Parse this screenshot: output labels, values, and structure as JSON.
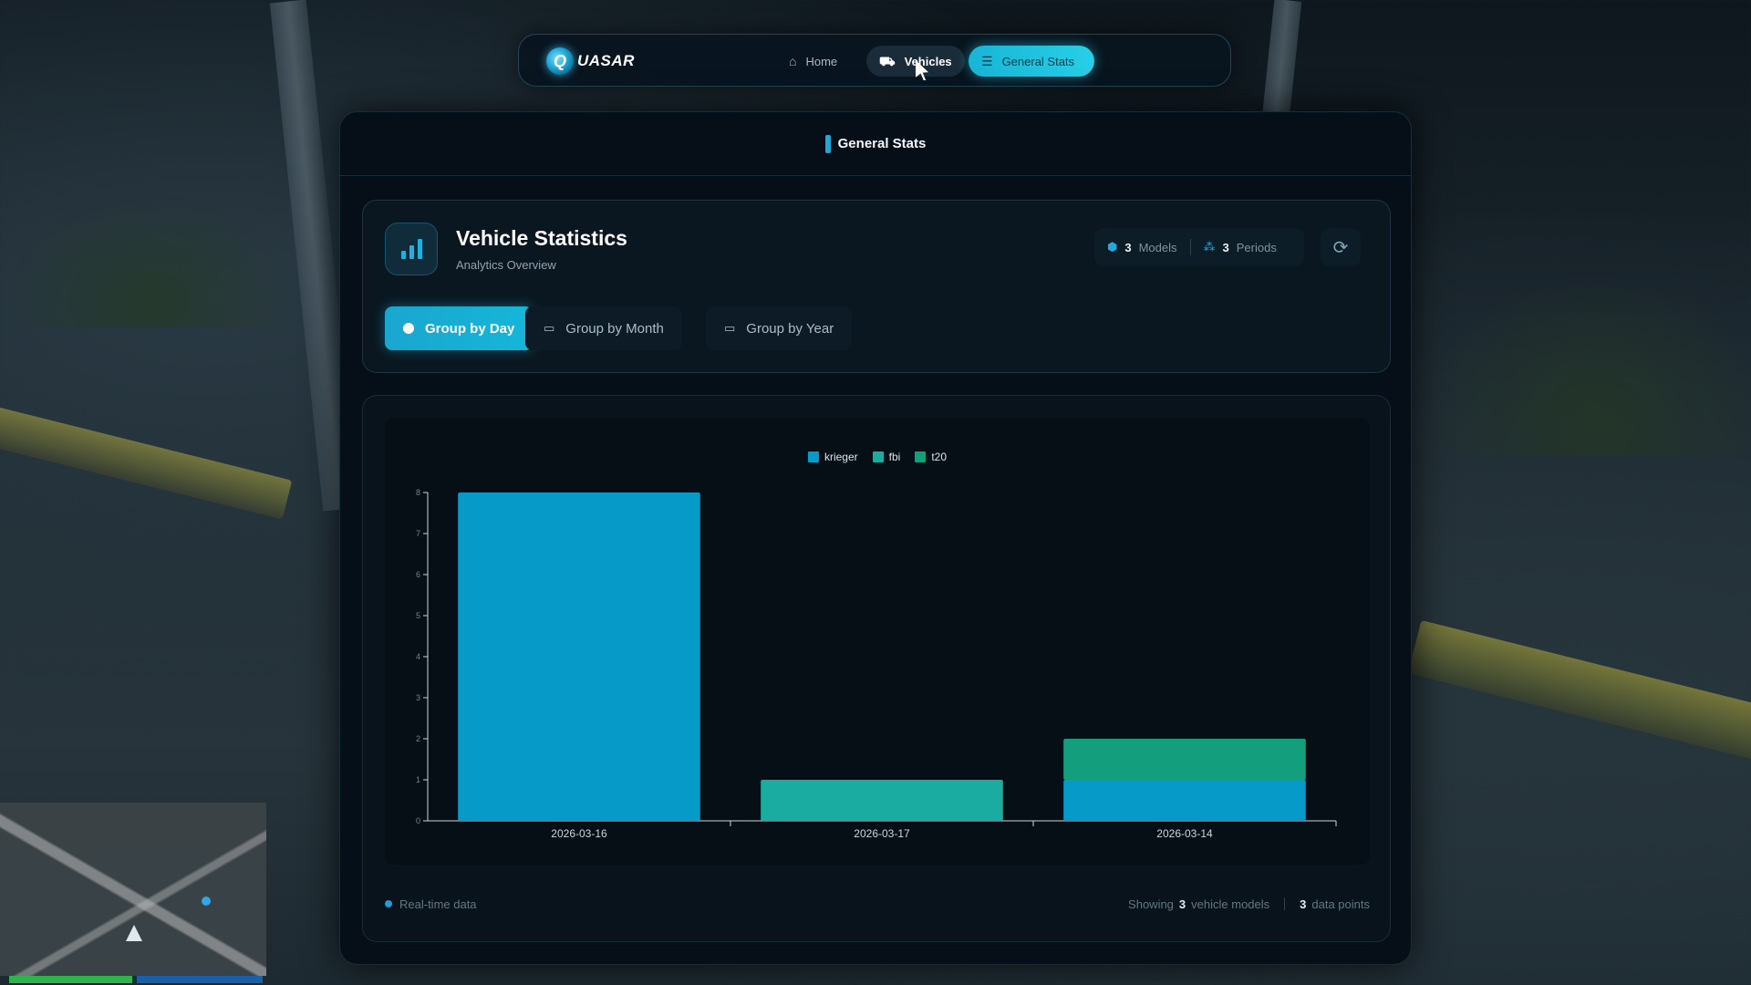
{
  "nav": {
    "logo_mark": "Q",
    "logo_text": "UASAR",
    "home_label": "Home",
    "vehicles_label": "Vehicles",
    "general_stats_label": "General Stats"
  },
  "panel": {
    "title": "General Stats"
  },
  "header": {
    "title": "Vehicle Statistics",
    "subtitle": "Analytics Overview",
    "models_count": "3",
    "models_label": "Models",
    "periods_count": "3",
    "periods_label": "Periods"
  },
  "group_by": {
    "day_label": "Group by Day",
    "month_label": "Group by Month",
    "year_label": "Group by Year",
    "selected": "day"
  },
  "colors": {
    "krieger": "#069ac8",
    "fbi": "#1aaca0",
    "t20": "#139e7d",
    "accent": "#16b6d9"
  },
  "chart_data": {
    "type": "bar",
    "stacked": true,
    "categories": [
      "2026-03-16",
      "2026-03-17",
      "2026-03-14"
    ],
    "series": [
      {
        "name": "krieger",
        "values": [
          8,
          0,
          1
        ]
      },
      {
        "name": "fbi",
        "values": [
          0,
          1,
          0
        ]
      },
      {
        "name": "t20",
        "values": [
          0,
          0,
          1
        ]
      }
    ],
    "ylim": [
      0,
      8
    ],
    "yticks": [
      "0",
      "1",
      "2",
      "3",
      "4",
      "5",
      "6",
      "7",
      "8"
    ],
    "legend_position": "top-center",
    "grid": false
  },
  "footer": {
    "realtime_label": "Real-time data",
    "showing_prefix": "Showing",
    "showing_count": "3",
    "showing_suffix": "vehicle models",
    "points_count": "3",
    "points_label": "data points"
  }
}
